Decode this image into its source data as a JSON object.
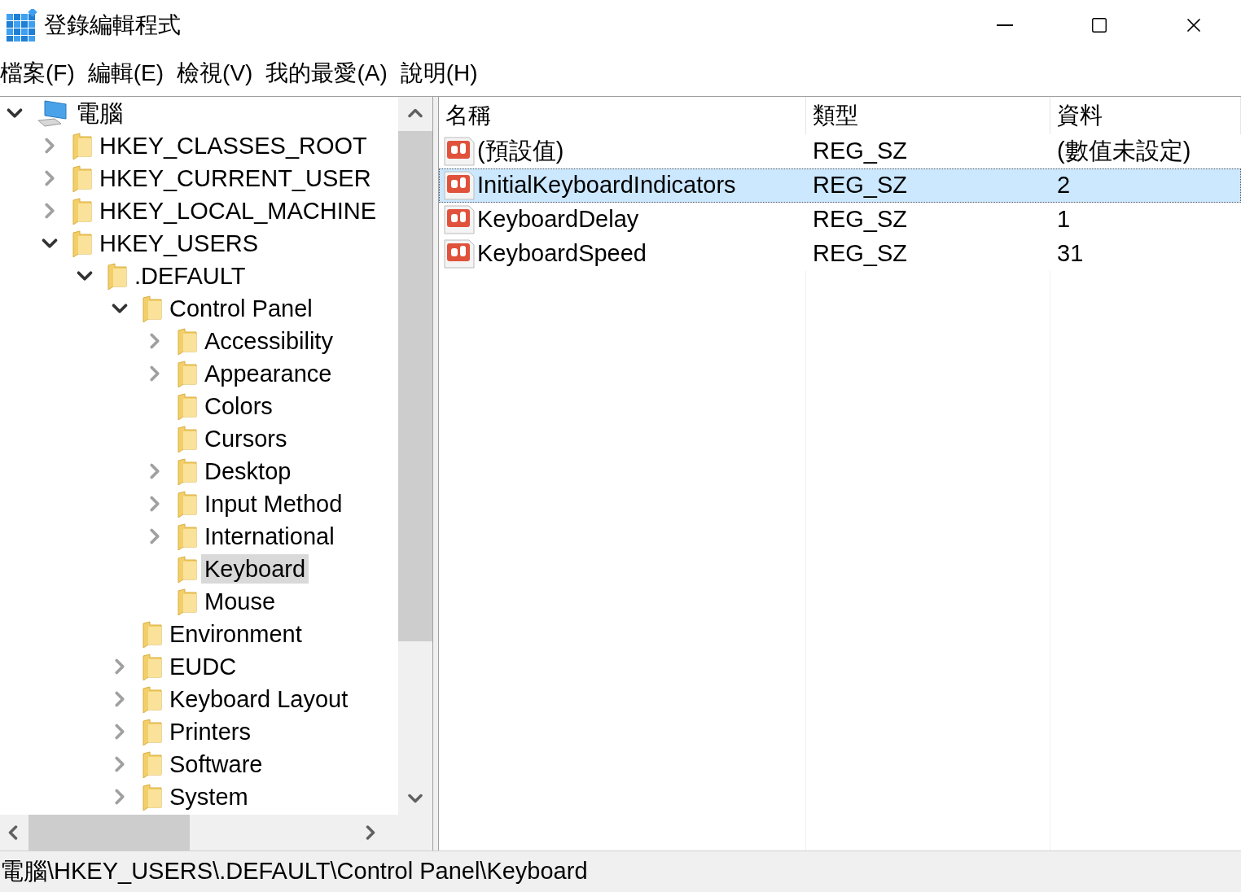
{
  "window": {
    "title": "登錄編輯程式"
  },
  "menu": [
    "檔案(F)",
    "編輯(E)",
    "檢視(V)",
    "我的最愛(A)",
    "說明(H)"
  ],
  "tree": [
    {
      "label": "電腦",
      "kind": "expanded",
      "selected": false,
      "children": [
        {
          "label": "HKEY_CLASSES_ROOT",
          "kind": "collapsed",
          "selected": false
        },
        {
          "label": "HKEY_CURRENT_USER",
          "kind": "collapsed",
          "selected": false
        },
        {
          "label": "HKEY_LOCAL_MACHINE",
          "kind": "collapsed",
          "selected": false
        },
        {
          "label": "HKEY_USERS",
          "kind": "expanded",
          "selected": false,
          "children": [
            {
              "label": ".DEFAULT",
              "kind": "expanded",
              "selected": false,
              "children": [
                {
                  "label": "Control Panel",
                  "kind": "expanded",
                  "selected": false,
                  "children": [
                    {
                      "label": "Accessibility",
                      "kind": "collapsed",
                      "selected": false
                    },
                    {
                      "label": "Appearance",
                      "kind": "collapsed",
                      "selected": false
                    },
                    {
                      "label": "Colors",
                      "kind": "leaf",
                      "selected": false
                    },
                    {
                      "label": "Cursors",
                      "kind": "leaf",
                      "selected": false
                    },
                    {
                      "label": "Desktop",
                      "kind": "collapsed",
                      "selected": false
                    },
                    {
                      "label": "Input Method",
                      "kind": "collapsed",
                      "selected": false
                    },
                    {
                      "label": "International",
                      "kind": "collapsed",
                      "selected": false
                    },
                    {
                      "label": "Keyboard",
                      "kind": "leaf",
                      "selected": true
                    },
                    {
                      "label": "Mouse",
                      "kind": "leaf",
                      "selected": false
                    }
                  ]
                },
                {
                  "label": "Environment",
                  "kind": "leaf",
                  "selected": false
                },
                {
                  "label": "EUDC",
                  "kind": "collapsed",
                  "selected": false
                },
                {
                  "label": "Keyboard Layout",
                  "kind": "collapsed",
                  "selected": false
                },
                {
                  "label": "Printers",
                  "kind": "collapsed",
                  "selected": false
                },
                {
                  "label": "Software",
                  "kind": "collapsed",
                  "selected": false
                },
                {
                  "label": "System",
                  "kind": "collapsed",
                  "selected": false
                }
              ]
            }
          ]
        }
      ]
    }
  ],
  "table": {
    "columns": [
      "名稱",
      "類型",
      "資料"
    ],
    "rows": [
      {
        "name": "(預設值)",
        "type": "REG_SZ",
        "data": "(數值未設定)",
        "selected": false
      },
      {
        "name": "InitialKeyboardIndicators",
        "type": "REG_SZ",
        "data": "2",
        "selected": true
      },
      {
        "name": "KeyboardDelay",
        "type": "REG_SZ",
        "data": "1",
        "selected": false
      },
      {
        "name": "KeyboardSpeed",
        "type": "REG_SZ",
        "data": "31",
        "selected": false
      }
    ]
  },
  "status_bar": "電腦\\HKEY_USERS\\.DEFAULT\\Control Panel\\Keyboard"
}
